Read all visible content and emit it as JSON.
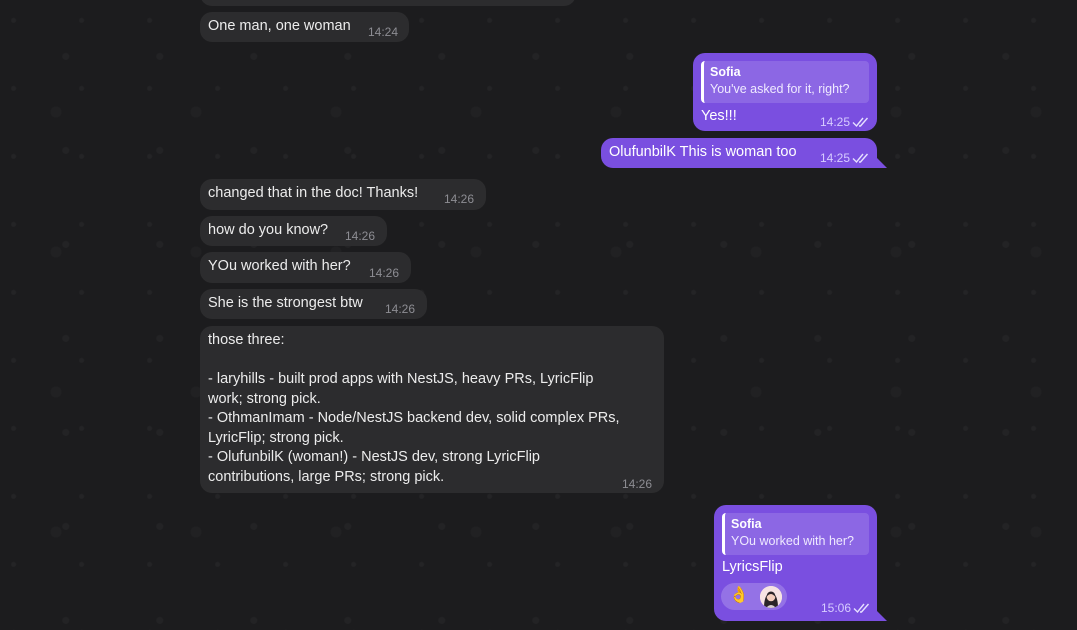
{
  "messages": [
    {
      "text": "One man, one woman",
      "time": "14:24"
    },
    {
      "reply_name": "Sofia",
      "reply_text": "You've asked for it, right?",
      "text": "Yes!!!",
      "time": "14:25"
    },
    {
      "text": "OlufunbilK This is woman too",
      "time": "14:25"
    },
    {
      "text": "changed that in the doc! Thanks!",
      "time": "14:26"
    },
    {
      "text": "how do you know?",
      "time": "14:26"
    },
    {
      "text": "YOu worked with her?",
      "time": "14:26"
    },
    {
      "text": "She is the strongest btw",
      "time": "14:26"
    },
    {
      "text": "those three:\n\n- laryhills - built prod apps with NestJS, heavy PRs, LyricFlip\nwork; strong pick.\n- OthmanImam - Node/NestJS backend dev, solid complex PRs,\nLyricFlip; strong pick.\n- OlufunbilK (woman!) - NestJS dev, strong LyricFlip\ncontributions, large PRs; strong pick.",
      "time": "14:26"
    },
    {
      "reply_name": "Sofia",
      "reply_text": "YOu worked with her?",
      "text": "LyricsFlip",
      "reaction": "👌",
      "time": "15:06"
    }
  ],
  "colors": {
    "background": "#1c1c1e",
    "incoming_bubble": "#2c2c2e",
    "outgoing_bubble": "#7a4fe0"
  },
  "icons": {
    "read_status": "double-check-icon",
    "reaction_avatar": "avatar"
  }
}
